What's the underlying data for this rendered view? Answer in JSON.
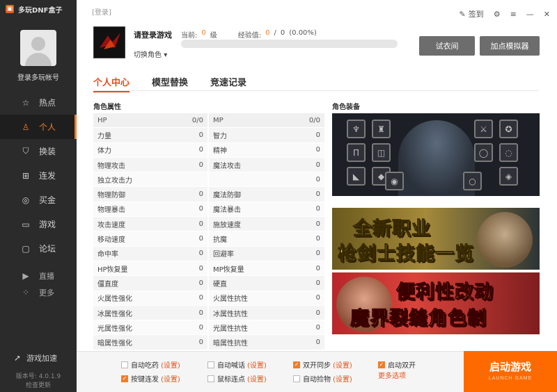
{
  "app": {
    "title": "多玩DNF盒子",
    "logo_icon": "box-logo-icon"
  },
  "user": {
    "login_label": "登录多玩帐号"
  },
  "nav": {
    "items": [
      {
        "label": "热点",
        "icon": "star-icon"
      },
      {
        "label": "个人",
        "icon": "user-icon"
      },
      {
        "label": "换装",
        "icon": "shirt-icon"
      },
      {
        "label": "连发",
        "icon": "grid-icon"
      },
      {
        "label": "买金",
        "icon": "coins-icon"
      },
      {
        "label": "游戏",
        "icon": "gamepad-icon"
      },
      {
        "label": "论坛",
        "icon": "chat-icon"
      }
    ],
    "active_index": 1,
    "sub_items": [
      {
        "label": "直播",
        "icon": "play-icon"
      },
      {
        "label": "更多",
        "icon": "apps-icon"
      }
    ]
  },
  "footer": {
    "accel_label": "游戏加速",
    "version": "版本号: 4.0.1.9",
    "update": "检查更新"
  },
  "header": {
    "login_hint": "[登录]",
    "checkin": "签到",
    "char_name": "请登录游戏",
    "switch_role": "切换角色",
    "level_label": "当前:",
    "level_value": "0",
    "level_unit": "级",
    "exp_label": "经验值:",
    "exp_current": "0",
    "exp_sep": "/",
    "exp_max": "0",
    "exp_pct": "(0.00%)",
    "exp_fraction": 0,
    "try_on_button": "试衣间",
    "simulator_button": "加点模拟器"
  },
  "tabs": [
    "个人中心",
    "模型替换",
    "竞速记录"
  ],
  "active_tab": 0,
  "attributes": {
    "title": "角色属性",
    "rows": [
      [
        {
          "name": "HP",
          "value": "0/0"
        },
        {
          "name": "MP",
          "value": "0/0"
        }
      ],
      [
        {
          "name": "力量",
          "value": "0"
        },
        {
          "name": "智力",
          "value": "0"
        }
      ],
      [
        {
          "name": "体力",
          "value": "0"
        },
        {
          "name": "精神",
          "value": "0"
        }
      ],
      [
        {
          "name": "物理攻击",
          "value": "0"
        },
        {
          "name": "魔法攻击",
          "value": "0"
        }
      ],
      [
        {
          "name": "独立攻击力",
          "value": ""
        },
        {
          "name": "",
          "value": "0"
        }
      ],
      [
        {
          "name": "物理防御",
          "value": "0"
        },
        {
          "name": "魔法防御",
          "value": "0"
        }
      ],
      [
        {
          "name": "物理暴击",
          "value": "0"
        },
        {
          "name": "魔法暴击",
          "value": "0"
        }
      ],
      [
        {
          "name": "攻击速度",
          "value": "0"
        },
        {
          "name": "施放速度",
          "value": "0"
        }
      ],
      [
        {
          "name": "移动速度",
          "value": "0"
        },
        {
          "name": "抗魔",
          "value": "0"
        }
      ],
      [
        {
          "name": "命中率",
          "value": "0"
        },
        {
          "name": "回避率",
          "value": "0"
        }
      ],
      [
        {
          "name": "HP恢复量",
          "value": "0"
        },
        {
          "name": "MP恢复量",
          "value": "0"
        }
      ],
      [
        {
          "name": "僵直度",
          "value": "0"
        },
        {
          "name": "硬直",
          "value": "0"
        }
      ],
      [
        {
          "name": "火属性强化",
          "value": "0"
        },
        {
          "name": "火属性抗性",
          "value": "0"
        }
      ],
      [
        {
          "name": "冰属性强化",
          "value": "0"
        },
        {
          "name": "冰属性抗性",
          "value": "0"
        }
      ],
      [
        {
          "name": "光属性强化",
          "value": "0"
        },
        {
          "name": "光属性抗性",
          "value": "0"
        }
      ],
      [
        {
          "name": "暗属性强化",
          "value": "0"
        },
        {
          "name": "暗属性抗性",
          "value": "0"
        }
      ]
    ]
  },
  "equipment": {
    "title": "角色装备"
  },
  "banners": [
    {
      "line1": "全新职业",
      "line2": "枪剑士技能一览"
    },
    {
      "line1": "便利性改动",
      "line2": "魔界裂缝角色制"
    }
  ],
  "options": [
    {
      "label": "自动吃药",
      "setting": "(设置)",
      "checked": false
    },
    {
      "label": "按键连发",
      "setting": "(设置)",
      "checked": true
    },
    {
      "label": "自动喊话",
      "setting": "(设置)",
      "checked": false
    },
    {
      "label": "鼠标连点",
      "setting": "(设置)",
      "checked": false
    },
    {
      "label": "双开同步",
      "setting": "(设置)",
      "checked": true
    },
    {
      "label": "自动捡物",
      "setting": "(设置)",
      "checked": false
    },
    {
      "label": "启动双开",
      "setting": "",
      "checked": true
    }
  ],
  "more_options": "更多选项",
  "launch": {
    "label": "启动游戏",
    "sub": "LAUNCH GAME"
  },
  "colors": {
    "accent": "#f07d2a",
    "sidebar": "#2b2b2b",
    "launch": "#ff6a00"
  }
}
